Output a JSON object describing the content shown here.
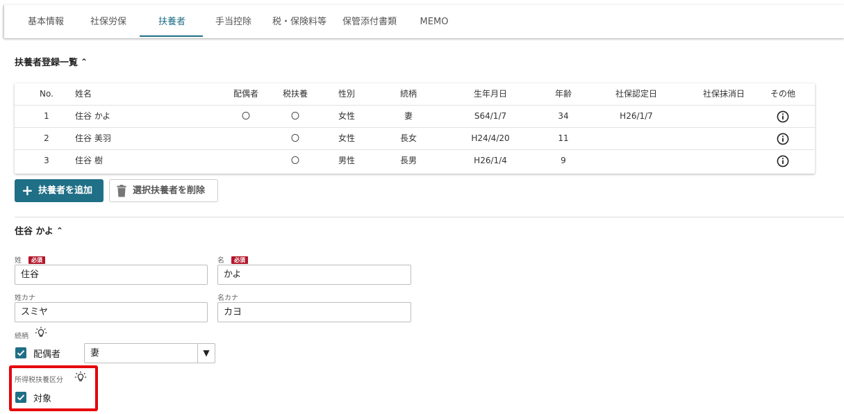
{
  "tabs": [
    {
      "label": "基本情報"
    },
    {
      "label": "社保労保"
    },
    {
      "label": "扶養者"
    },
    {
      "label": "手当控除"
    },
    {
      "label": "税・保険料等"
    },
    {
      "label": "保管添付書類"
    },
    {
      "label": "MEMO"
    }
  ],
  "active_tab": "扶養者",
  "list_section": {
    "title": "扶養者登録一覧"
  },
  "table": {
    "headers": [
      "No.",
      "姓名",
      "配偶者",
      "税扶養",
      "性別",
      "続柄",
      "生年月日",
      "年齢",
      "社保認定日",
      "社保抹消日",
      "その他"
    ],
    "rows": [
      {
        "no": "1",
        "name": "住谷 かよ",
        "spouse": "〇",
        "tax_dependent": "〇",
        "gender": "女性",
        "relation": "妻",
        "birth": "S64/1/7",
        "age": "34",
        "ins_date": "H26/1/7",
        "ins_remove": ""
      },
      {
        "no": "2",
        "name": "住谷 美羽",
        "spouse": "",
        "tax_dependent": "〇",
        "gender": "女性",
        "relation": "長女",
        "birth": "H24/4/20",
        "age": "11",
        "ins_date": "",
        "ins_remove": ""
      },
      {
        "no": "3",
        "name": "住谷 樹",
        "spouse": "",
        "tax_dependent": "〇",
        "gender": "男性",
        "relation": "長男",
        "birth": "H26/1/4",
        "age": "9",
        "ins_date": "",
        "ins_remove": ""
      }
    ]
  },
  "buttons": {
    "add": "扶養者を追加",
    "delete": "選択扶養者を削除"
  },
  "detail_section": {
    "title": "住谷 かよ"
  },
  "form": {
    "required_badge": "必須",
    "last_name": {
      "label": "姓",
      "value": "住谷"
    },
    "first_name": {
      "label": "名",
      "value": "かよ"
    },
    "last_name_kana": {
      "label": "姓カナ",
      "value": "スミヤ"
    },
    "first_name_kana": {
      "label": "名カナ",
      "value": "カヨ"
    },
    "relation": {
      "label": "続柄",
      "spouse_checkbox": "配偶者",
      "spouse_checked": true,
      "value": "妻"
    },
    "income_tax": {
      "label": "所得税扶養区分",
      "checkbox": "対象",
      "checked": true
    }
  },
  "colors": {
    "accent": "#1f6f86",
    "required": "#b3172b",
    "highlight": "#e5000a"
  }
}
